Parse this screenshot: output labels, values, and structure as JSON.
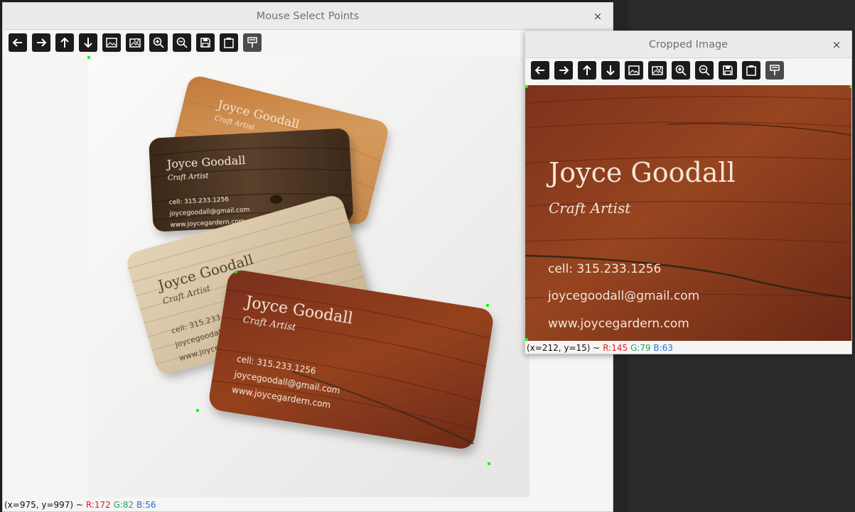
{
  "main_window": {
    "title": "Mouse Select Points",
    "close_glyph": "×",
    "status": {
      "coords": "(x=975, y=997) ~",
      "r": "R:172",
      "g": "G:82",
      "b": "B:56"
    }
  },
  "crop_window": {
    "title": "Cropped Image",
    "close_glyph": "×",
    "status": {
      "coords": "(x=212, y=15) ~",
      "r": "R:145",
      "g": "G:79",
      "b": "B:63"
    }
  },
  "toolbar_icons": [
    "back-arrow-icon",
    "forward-arrow-icon",
    "pan-up-icon",
    "pan-down-icon",
    "image-icon",
    "gallery-icon",
    "zoom-in-icon",
    "zoom-out-icon",
    "save-icon",
    "clipboard-icon",
    "properties-icon"
  ],
  "cards": {
    "name": "Joyce Goodall",
    "title": "Craft Artist",
    "phone": "cell: 315.233.1256",
    "email": "joycegoodall@gmail.com",
    "web": "www.joycegardern.com"
  },
  "colors": {
    "wood_red": "#8a3b22",
    "wood_dark": "#4a3422",
    "wood_light": "#d8c6a8",
    "wood_orange": "#c98a4a",
    "point_marker": "#00ff00"
  }
}
